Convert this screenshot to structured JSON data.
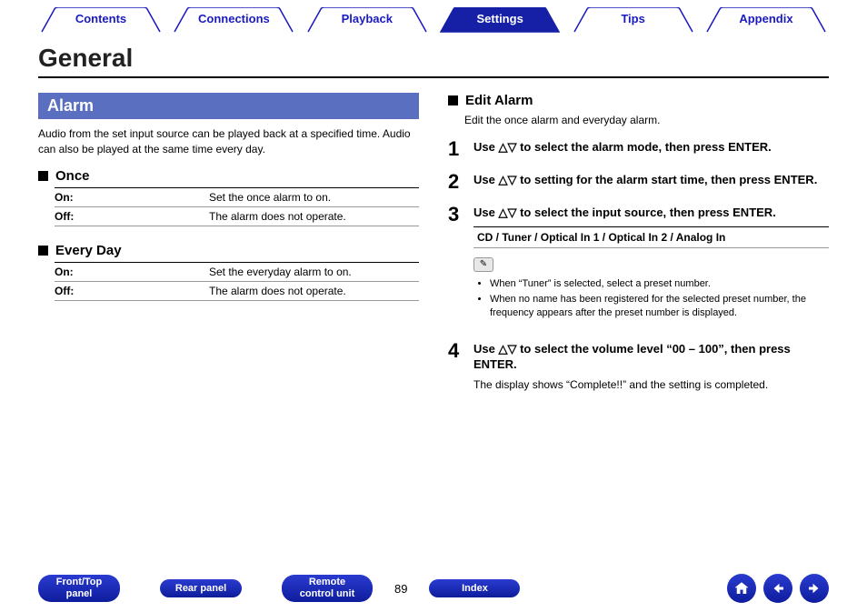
{
  "tabs": {
    "contents": "Contents",
    "connections": "Connections",
    "playback": "Playback",
    "settings": "Settings",
    "tips": "Tips",
    "appendix": "Appendix"
  },
  "page_title": "General",
  "left": {
    "alarm_heading": "Alarm",
    "alarm_intro": "Audio from the set input source can be played back at a specified time. Audio can also be played at the same time every day.",
    "once": {
      "title": "Once",
      "rows": [
        {
          "label": "On:",
          "desc": "Set the once alarm to on."
        },
        {
          "label": "Off:",
          "desc": "The alarm does not operate."
        }
      ]
    },
    "everyday": {
      "title": "Every Day",
      "rows": [
        {
          "label": "On:",
          "desc": "Set the everyday alarm to on."
        },
        {
          "label": "Off:",
          "desc": "The alarm does not operate."
        }
      ]
    }
  },
  "right": {
    "edit_title": "Edit Alarm",
    "edit_desc": "Edit the once alarm and everyday alarm.",
    "steps": {
      "s1": {
        "num": "1",
        "text_a": "Use ",
        "text_b": " to select the alarm mode, then press ENTER."
      },
      "s2": {
        "num": "2",
        "text_a": "Use ",
        "text_b": " to setting for the alarm start time, then press ENTER."
      },
      "s3": {
        "num": "3",
        "text_a": "Use ",
        "text_b": " to select the input source, then press ENTER.",
        "sources": "CD / Tuner / Optical In 1 / Optical In 2 / Analog In",
        "notes": [
          "When “Tuner” is selected, select a preset number.",
          "When no name has been registered for the selected preset number, the frequency appears after the preset number is displayed."
        ]
      },
      "s4": {
        "num": "4",
        "text_a": "Use ",
        "text_b": " to select the volume level “00 – 100”, then press ENTER.",
        "sub": "The display shows “Complete!!” and the setting is completed."
      }
    }
  },
  "footer": {
    "front_top": "Front/Top panel",
    "rear": "Rear panel",
    "remote": "Remote control unit",
    "page": "89",
    "index": "Index"
  },
  "glyphs": {
    "updown": "△▽",
    "pencil": "✎"
  }
}
